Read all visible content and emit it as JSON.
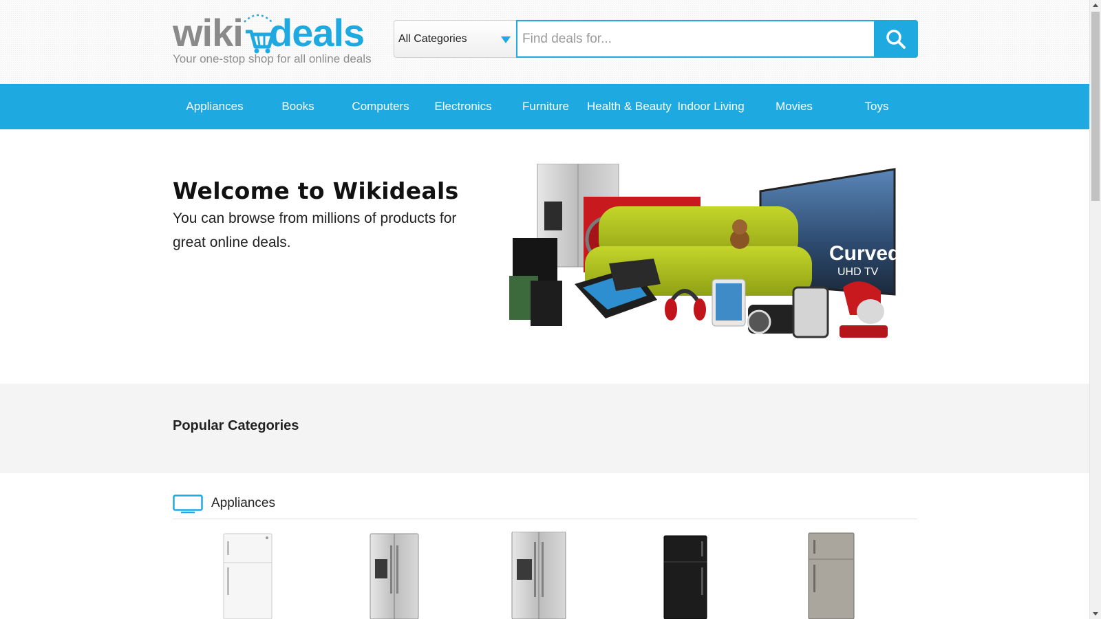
{
  "logo": {
    "wiki": "wiki",
    "deals": "deals",
    "tagline": "Your one-stop shop for all online deals"
  },
  "search": {
    "category_selected": "All Categories",
    "placeholder": "Find deals for...",
    "value": "",
    "button_icon": "search-icon"
  },
  "nav": {
    "items": [
      {
        "label": "Appliances"
      },
      {
        "label": "Books"
      },
      {
        "label": "Computers"
      },
      {
        "label": "Electronics"
      },
      {
        "label": "Furniture"
      },
      {
        "label": "Health & Beauty"
      },
      {
        "label": "Indoor Living"
      },
      {
        "label": "Movies"
      },
      {
        "label": "Toys"
      }
    ]
  },
  "hero": {
    "title": "Welcome to Wikideals",
    "text": "You can browse from millions of products for great online deals.",
    "image_caption_line1": "Curved",
    "image_caption_line2": "UHD TV"
  },
  "popular": {
    "title": "Popular Categories"
  },
  "section": {
    "icon": "monitor-icon",
    "label": "Appliances",
    "products": [
      {
        "name": "refrigerator-white",
        "color": "#f4f4f4"
      },
      {
        "name": "refrigerator-side-by-side-stainless",
        "color": "#b9bcbf"
      },
      {
        "name": "refrigerator-side-by-side-stainless-2",
        "color": "#b4b7ba"
      },
      {
        "name": "refrigerator-black",
        "color": "#1c1c1c"
      },
      {
        "name": "refrigerator-slate",
        "color": "#a8a39c"
      }
    ]
  },
  "colors": {
    "brand_blue": "#1fa9e1",
    "logo_gray": "#8a8a8a",
    "popular_bg": "#f4f4f4"
  }
}
